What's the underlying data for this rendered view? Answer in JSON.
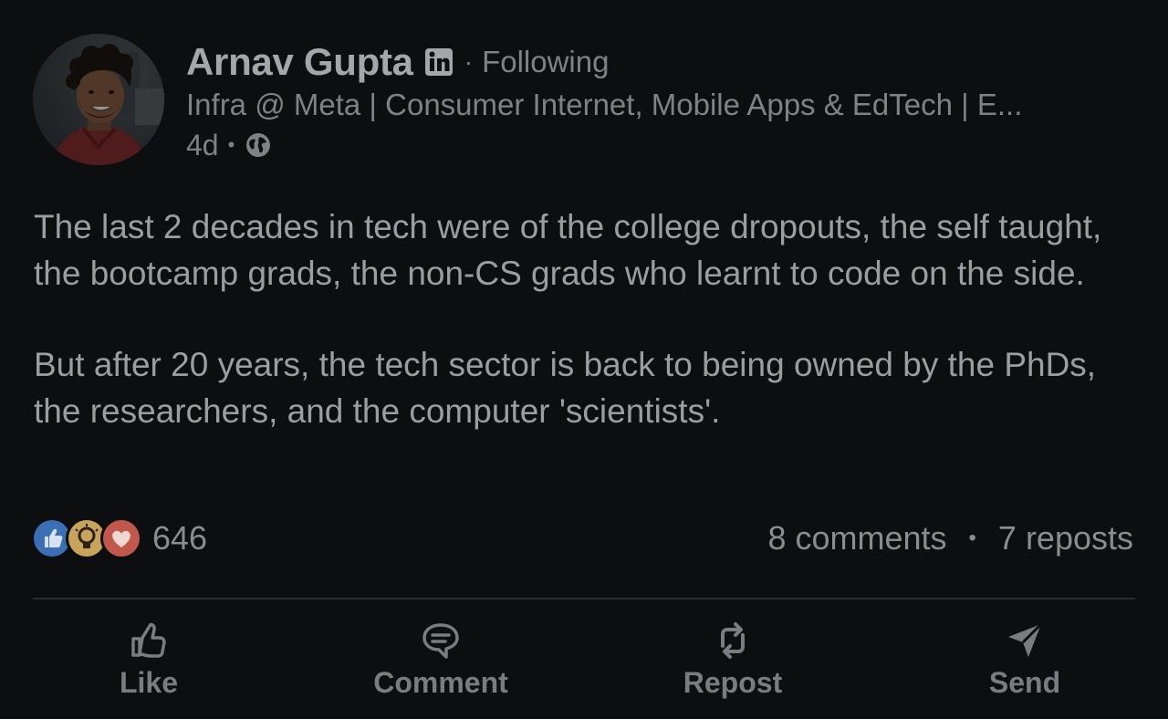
{
  "author": {
    "name": "Arnav Gupta",
    "follow_status": "Following",
    "headline": "Infra @ Meta | Consumer Internet, Mobile Apps & EdTech | E...",
    "time_ago": "4d",
    "meta_separator": "•",
    "name_separator": "·"
  },
  "post": {
    "paragraphs": [
      "The last 2 decades in tech were of the college dropouts, the self taught, the bootcamp grads, the non-CS grads who learnt to code on the side.",
      "But after 20 years, the tech sector is back to being owned by the PhDs, the researchers, and the computer 'scientists'."
    ]
  },
  "social": {
    "reaction_count": "646",
    "comments": "8 comments",
    "reposts": "7 reposts",
    "separator": "•"
  },
  "actions": {
    "like": "Like",
    "comment": "Comment",
    "repost": "Repost",
    "send": "Send"
  },
  "icons": {
    "linkedin_badge": "linkedin-icon",
    "visibility": "globe-icon",
    "reactions": [
      "like-reaction-icon",
      "insightful-reaction-icon",
      "love-reaction-icon"
    ],
    "like": "thumbs-up-icon",
    "comment": "comment-bubble-icon",
    "repost": "repost-arrows-icon",
    "send": "send-plane-icon"
  },
  "colors": {
    "background": "#0d0e10",
    "like_reaction": "#3a6fb3",
    "insightful_reaction": "#c8a45a",
    "love_reaction": "#c2584c"
  }
}
